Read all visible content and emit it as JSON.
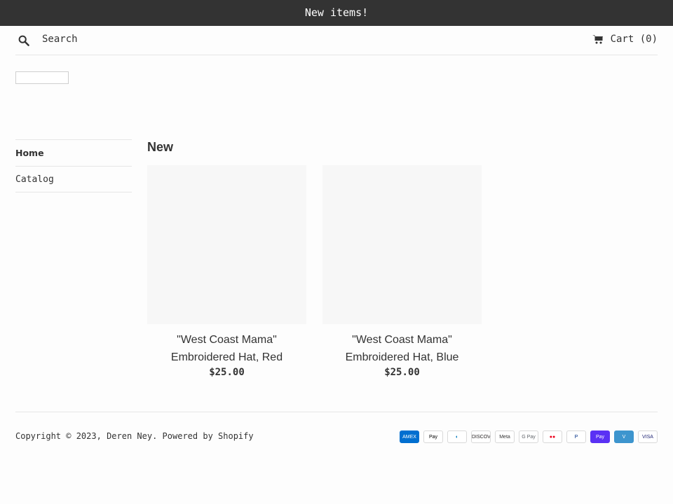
{
  "announcement": {
    "text": "New items!"
  },
  "header": {
    "search_placeholder": "Search",
    "cart_label": "Cart (0)"
  },
  "sidebar": {
    "items": [
      {
        "label": "Home"
      },
      {
        "label": "Catalog"
      }
    ]
  },
  "collection": {
    "title": "New",
    "products": [
      {
        "title_line1": "\"West Coast Mama\"",
        "title_line2": "Embroidered Hat, Red",
        "price": "$25.00"
      },
      {
        "title_line1": "\"West Coast Mama\"",
        "title_line2": "Embroidered Hat, Blue",
        "price": "$25.00"
      }
    ]
  },
  "footer": {
    "copyright_prefix": "Copyright © 2023,",
    "store_name": "Deren Ney",
    "powered_by": "Powered by Shopify",
    "payment_icons": [
      {
        "name": "amex-icon",
        "label": "AMEX",
        "bg": "#016fd0",
        "fg": "#ffffff"
      },
      {
        "name": "apple-pay-icon",
        "label": "Pay",
        "bg": "#ffffff",
        "fg": "#000000"
      },
      {
        "name": "diners-club-icon",
        "label": "◐",
        "bg": "#ffffff",
        "fg": "#0079be"
      },
      {
        "name": "discover-icon",
        "label": "DISCOVER",
        "bg": "#ffffff",
        "fg": "#231f20"
      },
      {
        "name": "meta-pay-icon",
        "label": "Meta",
        "bg": "#ffffff",
        "fg": "#333333"
      },
      {
        "name": "google-pay-icon",
        "label": "G Pay",
        "bg": "#ffffff",
        "fg": "#5f6368"
      },
      {
        "name": "mastercard-icon",
        "label": "●●",
        "bg": "#ffffff",
        "fg": "#eb001b"
      },
      {
        "name": "paypal-icon",
        "label": "P",
        "bg": "#ffffff",
        "fg": "#003087"
      },
      {
        "name": "shop-pay-icon",
        "label": "Pay",
        "bg": "#5a31f4",
        "fg": "#ffffff"
      },
      {
        "name": "venmo-icon",
        "label": "V",
        "bg": "#3d95ce",
        "fg": "#ffffff"
      },
      {
        "name": "visa-icon",
        "label": "VISA",
        "bg": "#ffffff",
        "fg": "#1a1f71"
      }
    ]
  }
}
